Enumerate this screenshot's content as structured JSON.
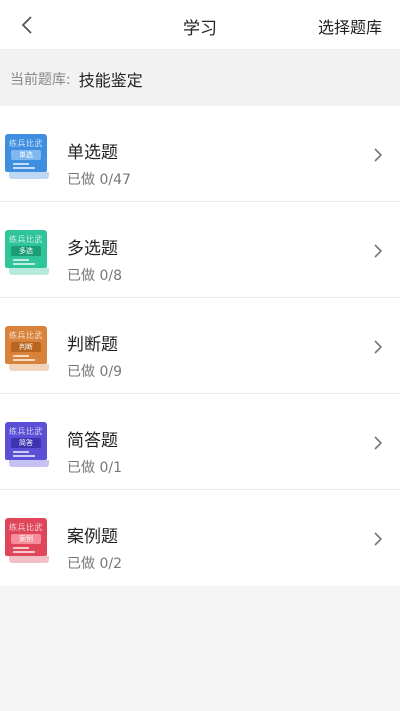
{
  "header": {
    "back_icon": "chevron-left-icon",
    "title": "学习",
    "select_bank_label": "选择题库"
  },
  "bank": {
    "label": "当前题库:",
    "name": "技能鉴定"
  },
  "items": [
    {
      "name": "单选题",
      "progress": "已做 0/47",
      "book_top": "练兵比武",
      "book_band": "单选",
      "color": "#3f8ee0",
      "band_color": "#7fb8f0",
      "icon": "book-icon"
    },
    {
      "name": "多选题",
      "progress": "已做 0/8",
      "book_top": "练兵比武",
      "book_band": "多选",
      "color": "#2fc49a",
      "band_color": "#1a9d74",
      "icon": "book-icon"
    },
    {
      "name": "判断题",
      "progress": "已做 0/9",
      "book_top": "练兵比武",
      "book_band": "判断",
      "color": "#d9823b",
      "band_color": "#b8651f",
      "icon": "book-icon"
    },
    {
      "name": "简答题",
      "progress": "已做 0/1",
      "book_top": "练兵比武",
      "book_band": "简答",
      "color": "#5a4fd6",
      "band_color": "#3e33b0",
      "icon": "book-icon"
    },
    {
      "name": "案例题",
      "progress": "已做 0/2",
      "book_top": "练兵比武",
      "book_band": "案例",
      "color": "#e0465a",
      "band_color": "#f58d9a",
      "icon": "book-icon"
    }
  ]
}
